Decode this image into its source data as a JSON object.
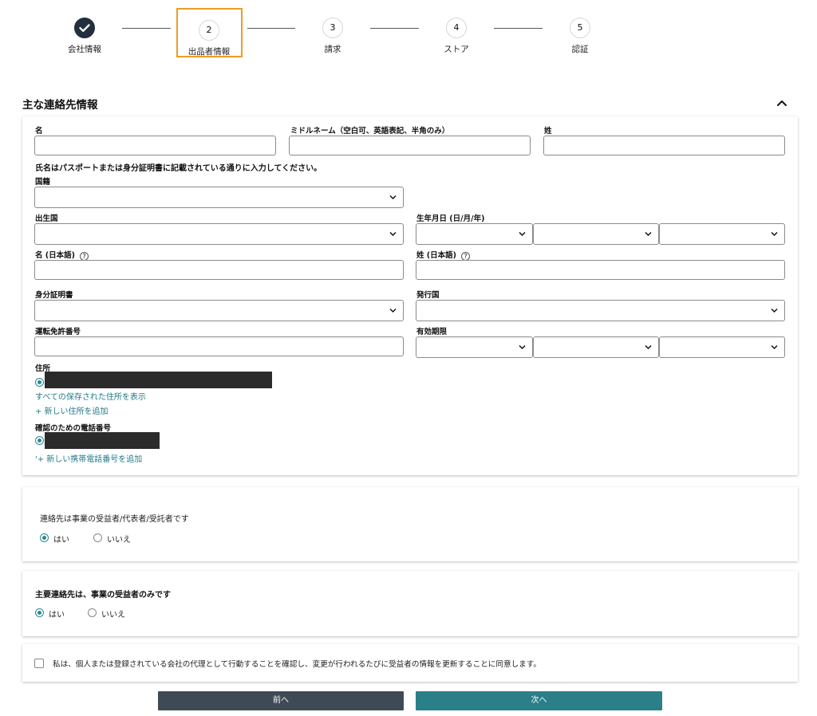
{
  "stepper": {
    "steps": [
      {
        "number": "",
        "label": "会社情報",
        "state": "done"
      },
      {
        "number": "2",
        "label": "出品者情報",
        "state": "active"
      },
      {
        "number": "3",
        "label": "請求",
        "state": "pending"
      },
      {
        "number": "4",
        "label": "ストア",
        "state": "pending"
      },
      {
        "number": "5",
        "label": "認証",
        "state": "pending"
      }
    ]
  },
  "section": {
    "title": "主な連絡先情報",
    "collapse_icon": "chevron-up-icon"
  },
  "form": {
    "first_name_label": "名",
    "middle_name_label": "ミドルネーム（空白可、英語表記、半角のみ）",
    "last_name_label": "姓",
    "first_name_value": "",
    "middle_name_value": "",
    "last_name_value": "",
    "name_note": "氏名はパスポートまたは身分証明書に記載されている通りに入力してください。",
    "nationality_label": "国籍",
    "nationality_value": "",
    "birth_country_label": "出生国",
    "birth_country_value": "",
    "dob_label": "生年月日 (日/月/年)",
    "first_name_ja_label": "名 (日本語)",
    "last_name_ja_label": "姓 (日本語)",
    "help_icon": "question-icon",
    "id_doc_label": "身分証明書",
    "id_doc_value": "",
    "issuing_country_label": "発行国",
    "issuing_country_value": "",
    "license_number_label": "運転免許番号",
    "expiry_label": "有効期限",
    "address_label": "住所",
    "show_saved_addresses": "すべての保存された住所を表示",
    "add_address": "+ 新しい住所を追加",
    "phone_label": "確認のための電話番号",
    "add_phone": "'+ 新しい携帯電話番号を追加"
  },
  "beneficiary": {
    "question": "連絡先は事業の受益者/代表者/受託者です",
    "yes": "はい",
    "no": "いいえ",
    "selected": "yes"
  },
  "sole_beneficiary": {
    "question": "主要連絡先は、事業の受益者のみです",
    "yes": "はい",
    "no": "いいえ",
    "selected": "yes"
  },
  "consent": {
    "text": "私は、個人または登録されている会社の代理として行動することを確認し、変更が行われるたびに受益者の情報を更新することに同意します。",
    "checked": false
  },
  "buttons": {
    "prev": "前へ",
    "next": "次へ"
  },
  "colors": {
    "accent": "#2b7f88",
    "active_step_border": "#ef9b28",
    "prev_button": "#3f4a57"
  }
}
